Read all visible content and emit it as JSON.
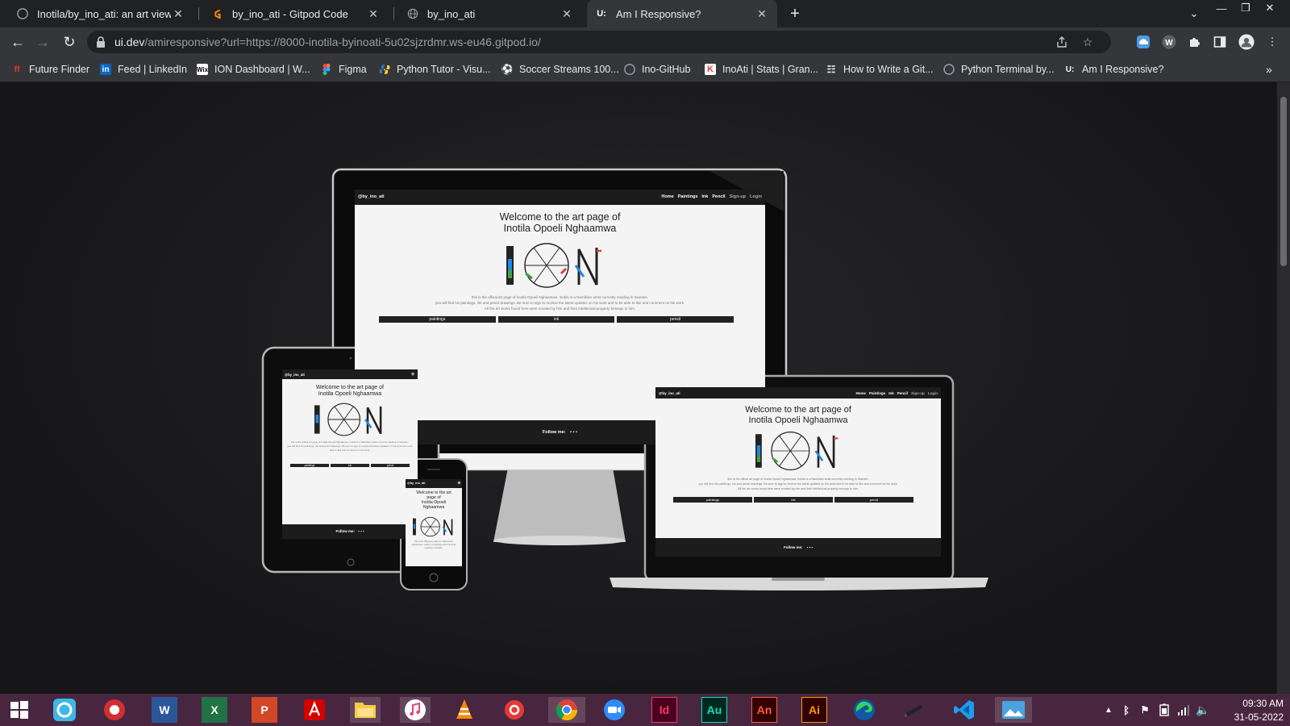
{
  "browser": {
    "tabs": [
      {
        "label": "Inotila/by_ino_ati: an art viewing",
        "icon": "github-icon"
      },
      {
        "label": "by_ino_ati - Gitpod Code",
        "icon": "gitpod-icon"
      },
      {
        "label": "by_ino_ati",
        "icon": "globe-icon"
      },
      {
        "label": "Am I Responsive?",
        "icon": "amiresponsive-icon",
        "active": true
      }
    ],
    "url_host": "ui.dev",
    "url_path": "/amiresponsive?url=https://8000-inotila-byinoati-5u02sjzrdmr.ws-eu46.gitpod.io/",
    "bookmarks": [
      {
        "label": "Future Finder",
        "icon": "futurefinder-icon"
      },
      {
        "label": "Feed | LinkedIn",
        "icon": "linkedin-icon"
      },
      {
        "label": "ION Dashboard | W...",
        "icon": "wix-icon"
      },
      {
        "label": "Figma",
        "icon": "figma-icon"
      },
      {
        "label": "Python Tutor - Visu...",
        "icon": "python-icon"
      },
      {
        "label": "Soccer Streams 100...",
        "icon": "soccer-icon"
      },
      {
        "label": "Ino-GitHub",
        "icon": "github-icon"
      },
      {
        "label": "InoAti | Stats | Gran...",
        "icon": "kaggle-icon"
      },
      {
        "label": "How to Write a Git...",
        "icon": "article-icon"
      },
      {
        "label": "Python Terminal by...",
        "icon": "terminal-icon"
      },
      {
        "label": "Am I Responsive?",
        "icon": "amiresponsive-icon"
      }
    ]
  },
  "site": {
    "brand": "@by_ino_ati",
    "nav": [
      "Home",
      "Paintings",
      "Ink",
      "Pencil",
      "Sign-up",
      "Login"
    ],
    "title_line1": "Welcome to the art page of",
    "title_line2": "Inotila Opoeli Nghaamwa",
    "title_phone1": "Welcome to the art",
    "title_phone2": "page of",
    "title_phone3": "Inotila Opoeli",
    "title_phone4": "Nghaamwa",
    "blurb1": "this is the offical art page of Inotila Opoeli Nghaamwa. Inotila is a Namibian artist currently residing in Sweden.",
    "blurb2": "you will find his paintings, ink and pencil drawings. Be sure to sign to receive the latest updates on his work and to be able to like and comment on his work.",
    "blurb3": "All the art works found here were created by him and their intellectual property belongs to him.",
    "categories": [
      "paintings",
      "ink",
      "pencil"
    ],
    "follow": "Follow me:"
  },
  "taskbar": {
    "apps": [
      "windows-start-icon",
      "file-manager-icon",
      "record-icon",
      "word-icon",
      "excel-icon",
      "powerpoint-icon",
      "acrobat-icon",
      "explorer-icon",
      "itunes-icon",
      "vlc-icon",
      "media-icon",
      "chrome-icon",
      "zoom-icon",
      "indesign-icon",
      "audition-icon",
      "animate-icon",
      "illustrator-icon",
      "edge-icon",
      "pen-icon",
      "vscode-icon",
      "photos-icon"
    ],
    "labels": {
      "word": "W",
      "excel": "X",
      "powerpoint": "P",
      "indesign": "Id",
      "audition": "Au",
      "animate": "An",
      "illustrator": "Ai"
    },
    "time": "09:30 AM",
    "date": "31-05-2022"
  },
  "colors": {
    "chrome_dark": "#202124",
    "chrome_mid": "#35363a",
    "taskbar": "#482640"
  }
}
